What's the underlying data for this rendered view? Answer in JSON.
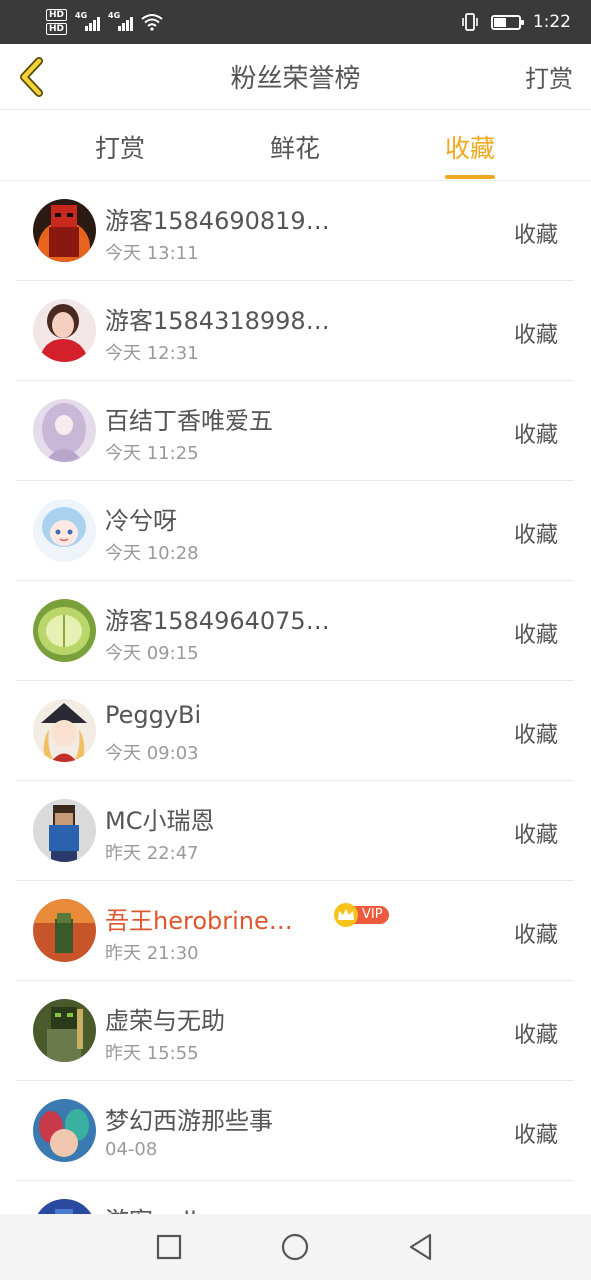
{
  "status_bar": {
    "hd1": "HD",
    "hd2": "HD",
    "net1": "4G",
    "net2": "4G",
    "time": "1:22",
    "battery_level": 0.5
  },
  "header": {
    "title": "粉丝荣誉榜",
    "action": "打赏"
  },
  "tabs": [
    {
      "label": "打赏",
      "active": false
    },
    {
      "label": "鲜花",
      "active": false
    },
    {
      "label": "收藏",
      "active": true
    }
  ],
  "list": [
    {
      "name": "游客1584690819…",
      "time": "今天 13:11",
      "action": "收藏",
      "avatar": "red-block-character"
    },
    {
      "name": "游客1584318998…",
      "time": "今天 12:31",
      "action": "收藏",
      "avatar": "woman-photo"
    },
    {
      "name": "百结丁香唯爱五",
      "time": "今天 11:25",
      "action": "收藏",
      "avatar": "anime-girl-purple"
    },
    {
      "name": "冷兮呀",
      "time": "今天 10:28",
      "action": "收藏",
      "avatar": "anime-girl-blue-hair"
    },
    {
      "name": "游客1584964075…",
      "time": "今天 09:15",
      "action": "收藏",
      "avatar": "green-fruit"
    },
    {
      "name": "PeggyBi",
      "time": "今天 09:03",
      "action": "收藏",
      "avatar": "anime-character-hat"
    },
    {
      "name": "MC小瑞恩",
      "time": "昨天 22:47",
      "action": "收藏",
      "avatar": "minecraft-character"
    },
    {
      "name": "吾王herobrine不…",
      "time": "昨天 21:30",
      "action": "收藏",
      "avatar": "minecraft-scene",
      "vip": "VIP"
    },
    {
      "name": "虚荣与无助",
      "time": "昨天 15:55",
      "action": "收藏",
      "avatar": "minecraft-armored"
    },
    {
      "name": "梦幻西游那些事",
      "time": "04-08",
      "action": "收藏",
      "avatar": "fantasy-game-characters"
    },
    {
      "name": "游客null",
      "time": "",
      "action": "",
      "avatar": "blue-avatar"
    }
  ],
  "colors": {
    "accent": "#f0a81e",
    "vip_name": "#e0562c",
    "text": "#555555",
    "subtext": "#9a9a9a"
  }
}
